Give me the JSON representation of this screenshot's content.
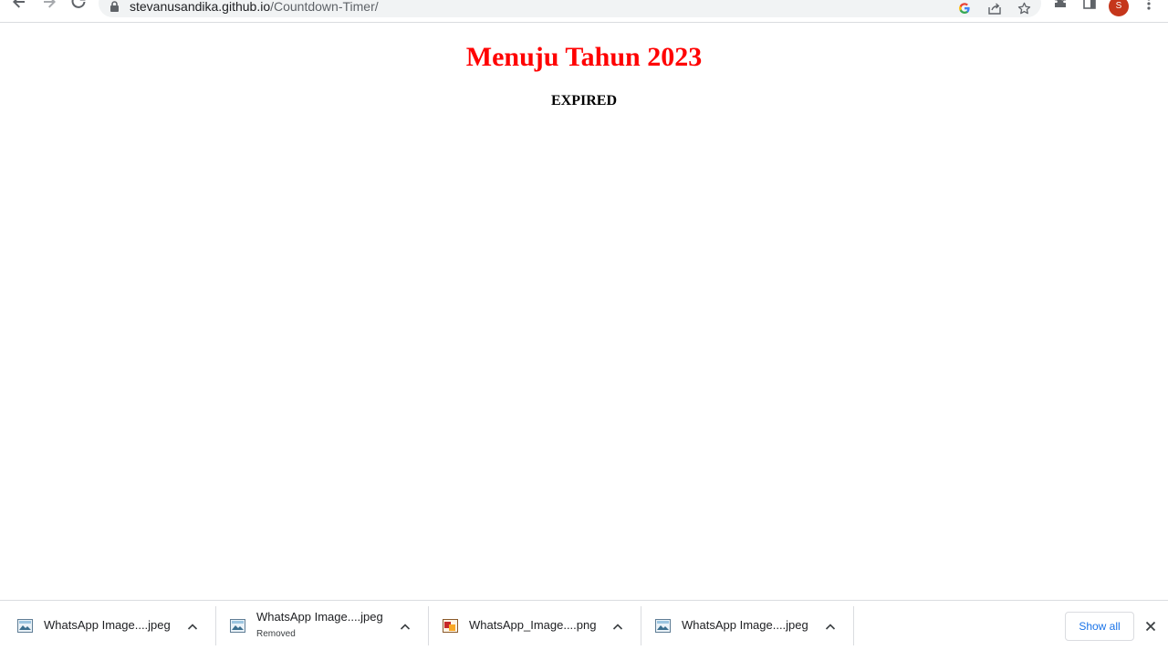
{
  "browser": {
    "url_host": "stevanusandika.github.io",
    "url_path": "/Countdown-Timer/",
    "profile_initial": "S"
  },
  "page": {
    "title": "Menuju Tahun 2023",
    "countdown_text": "EXPIRED",
    "title_color": "#ff0000"
  },
  "downloads": {
    "items": [
      {
        "name": "WhatsApp Image....jpeg",
        "status": "",
        "icon": "image-file-icon"
      },
      {
        "name": "WhatsApp Image....jpeg",
        "status": "Removed",
        "icon": "image-file-icon"
      },
      {
        "name": "WhatsApp_Image....png",
        "status": "",
        "icon": "png-file-icon"
      },
      {
        "name": "WhatsApp Image....jpeg",
        "status": "",
        "icon": "image-file-icon"
      }
    ],
    "show_all_label": "Show all"
  }
}
